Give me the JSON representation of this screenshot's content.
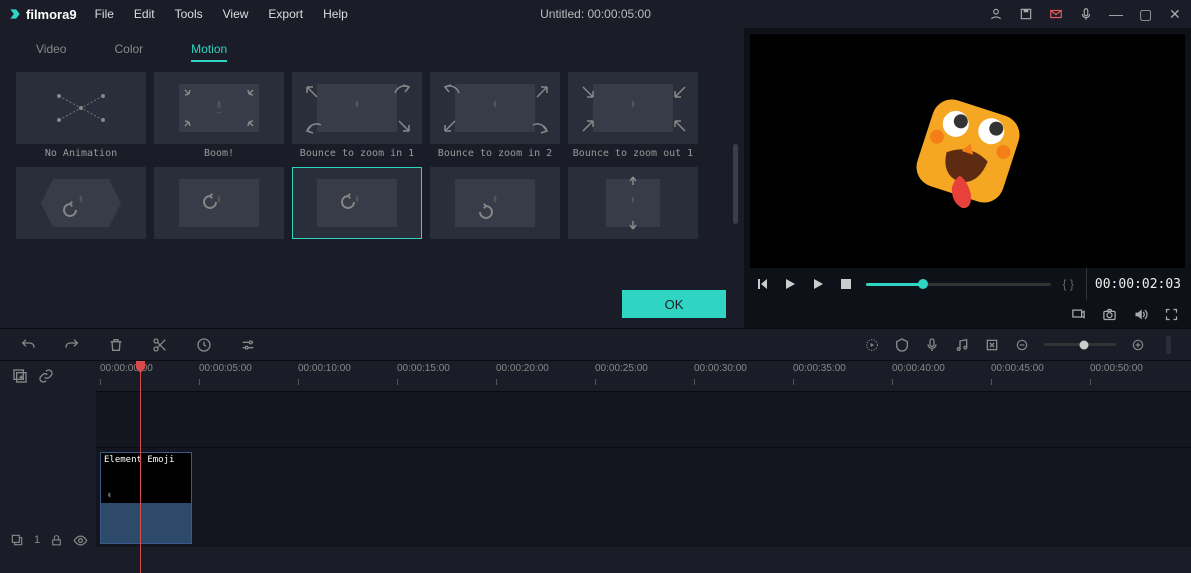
{
  "app": {
    "name": "filmora",
    "version": "9"
  },
  "menubar": [
    "File",
    "Edit",
    "Tools",
    "View",
    "Export",
    "Help"
  ],
  "title": "Untitled:  00:00:05:00",
  "tabs": {
    "items": [
      "Video",
      "Color",
      "Motion"
    ],
    "active": 2
  },
  "motion_presets": [
    {
      "label": "No Animation",
      "icon": "none"
    },
    {
      "label": "Boom!",
      "icon": "boom"
    },
    {
      "label": "Bounce to zoom in 1",
      "icon": "bounce-in-1"
    },
    {
      "label": "Bounce to zoom in 2",
      "icon": "bounce-in-2"
    },
    {
      "label": "Bounce to zoom out 1",
      "icon": "bounce-out-1"
    },
    {
      "label": "",
      "icon": "spin-cw"
    },
    {
      "label": "",
      "icon": "spin-cw"
    },
    {
      "label": "",
      "icon": "spin-cw",
      "selected": true
    },
    {
      "label": "",
      "icon": "spin-ccw"
    },
    {
      "label": "",
      "icon": "vertical"
    }
  ],
  "ok_label": "OK",
  "playback": {
    "time": "00:00:02:03",
    "braces": "{  }"
  },
  "timeline": {
    "ruler": [
      "00:00:00:00",
      "00:00:05:00",
      "00:00:10:00",
      "00:00:15:00",
      "00:00:20:00",
      "00:00:25:00",
      "00:00:30:00",
      "00:00:35:00",
      "00:00:40:00",
      "00:00:45:00",
      "00:00:50:00"
    ],
    "track_label": "1",
    "clip_name": "Element Emoji",
    "media_count": "1"
  }
}
